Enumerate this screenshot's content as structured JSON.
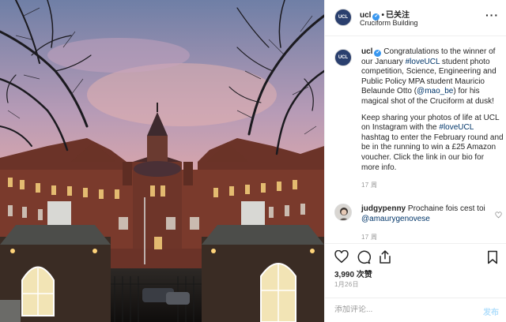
{
  "post": {
    "username": "ucl",
    "verified_symbol": "✔",
    "follow_separator": "•",
    "follow_label": "已关注",
    "location": "Cruciform Building",
    "more_icon": "more-options-icon",
    "avatar_text": "UCL"
  },
  "caption": {
    "username": "ucl",
    "text_1a": " Congratulations to the winner of our January ",
    "hashtag_1": "#loveUCL",
    "text_1b": " student photo competition, Science, Engineering and Public Policy MPA student Mauricio Belaunde Otto (",
    "mention": "@mao_be",
    "text_1c": ") for his magical shot of the Cruciform at dusk!",
    "text_2a": "Keep sharing your photos of life at UCL on Instagram with the ",
    "hashtag_2": "#loveUCL",
    "text_2b": " hashtag to enter the February round and be in the running to win a £25 Amazon voucher. Click the link in our bio for more info.",
    "time": "17 周"
  },
  "comment": {
    "username": "judgypenny",
    "text": " Prochaine fois cest toi ",
    "mention": "@amaurygenovese",
    "time": "17 周",
    "like_icon": "heart-icon"
  },
  "actions": {
    "icons": [
      "heart-icon",
      "comment-icon",
      "share-icon",
      "bookmark-icon"
    ],
    "likes": "3,990 次赞",
    "date": "1月26日",
    "comment_placeholder": "添加评论...",
    "post_label": "发布"
  },
  "colors": {
    "link": "#003569",
    "verified": "#3897f0",
    "post_button": "#b2dffc",
    "muted": "#999999"
  }
}
